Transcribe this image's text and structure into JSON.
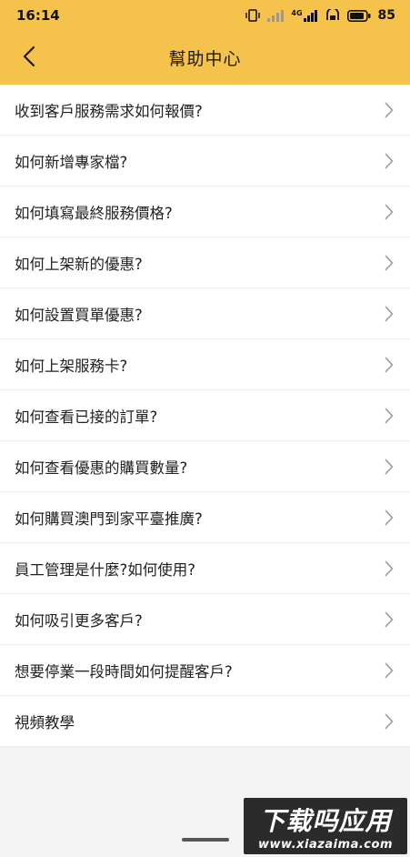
{
  "status_bar": {
    "time": "16:14",
    "network_label": "4G",
    "battery": "85",
    "icons": [
      "vibrate-icon",
      "signal-icon",
      "signal-4g-icon",
      "hd-icon",
      "battery-icon"
    ]
  },
  "header": {
    "title": "幫助中心",
    "back_icon": "chevron-left-icon",
    "accent_color": "#f5c24b"
  },
  "help_items": [
    {
      "label": "收到客戶服務需求如何報價?"
    },
    {
      "label": "如何新增專家檔?"
    },
    {
      "label": "如何填寫最終服務價格?"
    },
    {
      "label": "如何上架新的優惠?"
    },
    {
      "label": "如何設置買單優惠?"
    },
    {
      "label": "如何上架服務卡?"
    },
    {
      "label": "如何查看已接的訂單?"
    },
    {
      "label": "如何查看優惠的購買數量?"
    },
    {
      "label": "如何購買澳門到家平臺推廣?"
    },
    {
      "label": "員工管理是什麼?如何使用?"
    },
    {
      "label": "如何吸引更多客戶?"
    },
    {
      "label": "想要停業一段時間如何提醒客戶?"
    },
    {
      "label": "視頻教學"
    }
  ],
  "watermark": {
    "title": "下载吗应用",
    "url": "www.xiazaima.com"
  }
}
